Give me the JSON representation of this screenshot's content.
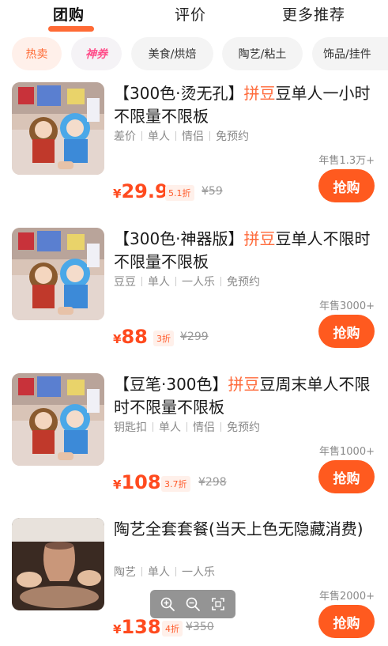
{
  "tabs": [
    {
      "label": "团购"
    },
    {
      "label": "评价"
    },
    {
      "label": "更多推荐"
    }
  ],
  "chips": [
    {
      "label": "热卖"
    },
    {
      "label": "神券"
    },
    {
      "label": "美食/烘焙"
    },
    {
      "label": "陶艺/粘土"
    },
    {
      "label": "饰品/挂件"
    }
  ],
  "items": [
    {
      "title_pre": "【300色·烫无孔】",
      "title_hl": "拼豆",
      "title_post": "豆单人一小时不限量不限板",
      "tags": [
        "差价",
        "单人",
        "情侣",
        "免预约"
      ],
      "sales": "年售1.3万+",
      "yen": "¥",
      "price": "29.9",
      "discount": "5.1折",
      "original": "¥59",
      "buy": "抢购",
      "thumb_icon": "perler-bead-photo"
    },
    {
      "title_pre": "【300色·神器版】",
      "title_hl": "拼豆",
      "title_post": "豆单人不限时不限量不限板",
      "tags": [
        "豆豆",
        "单人",
        "一人乐",
        "免预约"
      ],
      "sales": "年售3000+",
      "yen": "¥",
      "price": "88",
      "discount": "3折",
      "original": "¥299",
      "buy": "抢购",
      "thumb_icon": "perler-bead-photo"
    },
    {
      "title_pre": "【豆笔·300色】",
      "title_hl": "拼豆",
      "title_post": "豆周末单人不限时不限量不限板",
      "tags": [
        "钥匙扣",
        "单人",
        "情侣",
        "免预约"
      ],
      "sales": "年售1000+",
      "yen": "¥",
      "price": "108",
      "discount": "3.7折",
      "original": "¥298",
      "buy": "抢购",
      "thumb_icon": "perler-bead-photo"
    },
    {
      "title_pre": "陶艺全套套餐(当天上色无隐藏消费)",
      "title_hl": "",
      "title_post": "",
      "tags": [
        "陶艺",
        "单人",
        "一人乐"
      ],
      "sales": "年售2000+",
      "yen": "¥",
      "price": "138",
      "discount": "4折",
      "original": "¥350",
      "buy": "抢购",
      "thumb_icon": "pottery-wheel-photo"
    }
  ],
  "zoom_controls": {
    "zoom_in_icon": "zoom-in-icon",
    "zoom_out_icon": "zoom-out-icon",
    "fit_icon": "fit-screen-icon"
  },
  "colors": {
    "accent": "#ff5a1f",
    "price": "#ff4a1e",
    "highlight": "#ff6a3a"
  }
}
